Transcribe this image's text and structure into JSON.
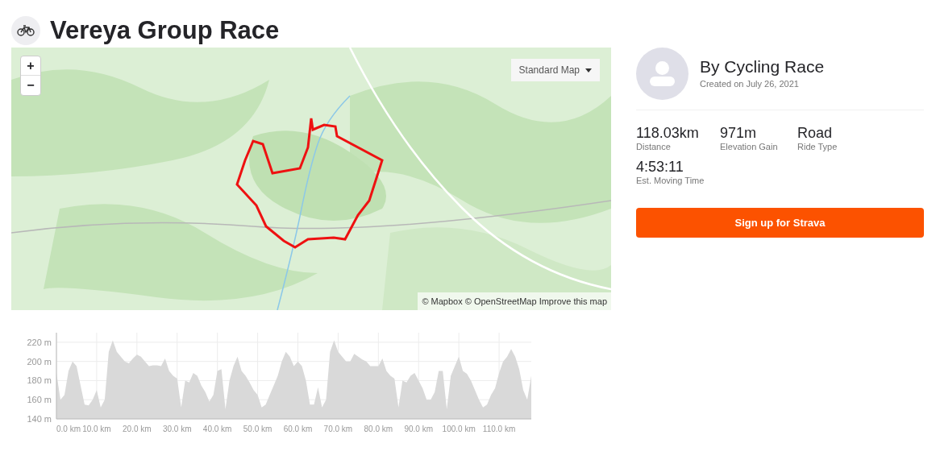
{
  "header": {
    "title": "Vereya Group Race"
  },
  "map": {
    "kind": "picture",
    "zoom_in": "+",
    "zoom_out": "−",
    "style_select": "Standard Map",
    "attribution": "© Mapbox © OpenStreetMap Improve this map"
  },
  "owner": {
    "name": "By Cycling Race",
    "created": "Created on July 26, 2021"
  },
  "stats": [
    {
      "value": "118.03km",
      "label": "Distance"
    },
    {
      "value": "971m",
      "label": "Elevation Gain"
    },
    {
      "value": "Road",
      "label": "Ride Type"
    },
    {
      "value": "4:53:11",
      "label": "Est. Moving Time"
    }
  ],
  "signup_button": "Sign up for Strava",
  "elevation": {
    "chart_data": {
      "type": "area",
      "x": [
        0,
        1,
        2,
        3,
        4,
        5,
        6,
        7,
        8,
        9,
        10,
        11,
        12,
        13,
        14,
        15,
        16,
        17,
        18,
        19,
        20,
        21,
        22,
        23,
        24,
        25,
        26,
        27,
        28,
        29,
        30,
        31,
        32,
        33,
        34,
        35,
        36,
        37,
        38,
        39,
        40,
        41,
        42,
        43,
        44,
        45,
        46,
        47,
        48,
        49,
        50,
        51,
        52,
        53,
        54,
        55,
        56,
        57,
        58,
        59,
        60,
        61,
        62,
        63,
        64,
        65,
        66,
        67,
        68,
        69,
        70,
        71,
        72,
        73,
        74,
        75,
        76,
        77,
        78,
        79,
        80,
        81,
        82,
        83,
        84,
        85,
        86,
        87,
        88,
        89,
        90,
        91,
        92,
        93,
        94,
        95,
        96,
        97,
        98,
        99,
        100,
        101,
        102,
        103,
        104,
        105,
        106,
        107,
        108,
        109,
        110,
        111,
        112,
        113,
        114,
        115,
        116,
        117,
        118
      ],
      "grid": true,
      "series": [
        {
          "color": "#d9d9d9",
          "values": [
            188,
            160,
            165,
            190,
            200,
            195,
            175,
            155,
            154,
            160,
            170,
            152,
            160,
            210,
            222,
            210,
            205,
            200,
            198,
            203,
            207,
            205,
            200,
            195,
            196,
            196,
            195,
            203,
            190,
            185,
            182,
            152,
            180,
            178,
            188,
            185,
            175,
            168,
            158,
            165,
            190,
            192,
            150,
            180,
            195,
            205,
            190,
            185,
            178,
            170,
            165,
            152,
            155,
            165,
            175,
            185,
            200,
            210,
            205,
            195,
            200,
            195,
            180,
            155,
            155,
            173,
            152,
            160,
            210,
            222,
            210,
            205,
            200,
            200,
            208,
            205,
            202,
            200,
            195,
            195,
            195,
            203,
            190,
            185,
            182,
            152,
            180,
            178,
            185,
            188,
            180,
            172,
            160,
            160,
            168,
            190,
            190,
            150,
            185,
            195,
            205,
            190,
            187,
            180,
            170,
            160,
            152,
            155,
            165,
            172,
            188,
            200,
            205,
            213,
            205,
            192,
            170,
            160,
            185
          ]
        }
      ],
      "xlim": [
        0,
        118
      ],
      "ylim": [
        140,
        230
      ],
      "xticks": [
        {
          "value": 0,
          "label": "0.0 km"
        },
        {
          "value": 10,
          "label": "10.0 km"
        },
        {
          "value": 20,
          "label": "20.0 km"
        },
        {
          "value": 30,
          "label": "30.0 km"
        },
        {
          "value": 40,
          "label": "40.0 km"
        },
        {
          "value": 50,
          "label": "50.0 km"
        },
        {
          "value": 60,
          "label": "60.0 km"
        },
        {
          "value": 70,
          "label": "70.0 km"
        },
        {
          "value": 80,
          "label": "80.0 km"
        },
        {
          "value": 90,
          "label": "90.0 km"
        },
        {
          "value": 100,
          "label": "100.0 km"
        },
        {
          "value": 110,
          "label": "110.0 km"
        }
      ],
      "yticks": [
        {
          "value": 140,
          "label": "140 m"
        },
        {
          "value": 160,
          "label": "160 m"
        },
        {
          "value": 180,
          "label": "180 m"
        },
        {
          "value": 200,
          "label": "200 m"
        },
        {
          "value": 220,
          "label": "220 m"
        }
      ]
    }
  }
}
